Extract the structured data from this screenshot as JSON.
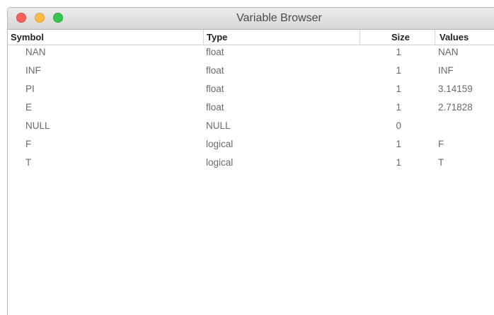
{
  "window": {
    "title": "Variable Browser"
  },
  "table": {
    "columns": {
      "symbol": "Symbol",
      "type": "Type",
      "size": "Size",
      "values": "Values"
    },
    "rows": [
      {
        "symbol": "NAN",
        "type": "float",
        "size": "1",
        "values": "NAN"
      },
      {
        "symbol": "INF",
        "type": "float",
        "size": "1",
        "values": "INF"
      },
      {
        "symbol": "PI",
        "type": "float",
        "size": "1",
        "values": "3.14159"
      },
      {
        "symbol": "E",
        "type": "float",
        "size": "1",
        "values": "2.71828"
      },
      {
        "symbol": "NULL",
        "type": "NULL",
        "size": "0",
        "values": ""
      },
      {
        "symbol": "F",
        "type": "logical",
        "size": "1",
        "values": "F"
      },
      {
        "symbol": "T",
        "type": "logical",
        "size": "1",
        "values": "T"
      }
    ]
  }
}
